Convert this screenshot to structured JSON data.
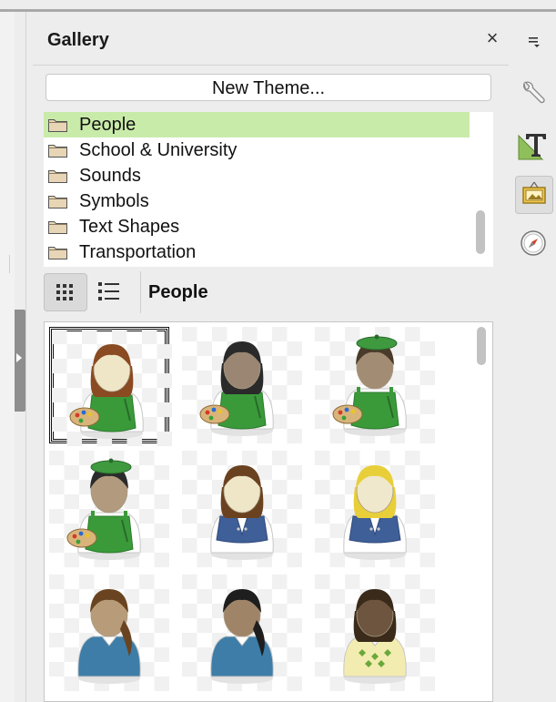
{
  "panel": {
    "title": "Gallery",
    "close_symbol": "×"
  },
  "new_theme_button": {
    "label": "New Theme..."
  },
  "themes": {
    "items": [
      {
        "label": "People",
        "selected": true
      },
      {
        "label": "School & University",
        "selected": false
      },
      {
        "label": "Sounds",
        "selected": false
      },
      {
        "label": "Symbols",
        "selected": false
      },
      {
        "label": "Text Shapes",
        "selected": false
      },
      {
        "label": "Transportation",
        "selected": false
      }
    ]
  },
  "view_toolbar": {
    "icon_view_icon": "grid-icon",
    "detail_view_icon": "list-icon",
    "active_view": "icon",
    "current_theme": "People"
  },
  "gallery_items": [
    {
      "name": "woman-painter-brown-hair",
      "selected": true
    },
    {
      "name": "woman-painter-black-hair",
      "selected": false
    },
    {
      "name": "man-painter-beret",
      "selected": false
    },
    {
      "name": "man-painter-beret-black-hair",
      "selected": false
    },
    {
      "name": "woman-brown-hair-vest",
      "selected": false
    },
    {
      "name": "woman-blonde-vest",
      "selected": false
    },
    {
      "name": "woman-ponytail-blue-sweater",
      "selected": false
    },
    {
      "name": "woman-black-ponytail-blue-sweater",
      "selected": false
    },
    {
      "name": "woman-argyle-sweater",
      "selected": false
    }
  ],
  "sidebar": {
    "menu_icon": "sidebar-menu-icon",
    "buttons": [
      {
        "icon": "properties-wrench-icon",
        "active": false
      },
      {
        "icon": "styles-icon",
        "active": false
      },
      {
        "icon": "gallery-icon",
        "active": true
      },
      {
        "icon": "navigator-icon",
        "active": false
      }
    ]
  },
  "colors": {
    "selected_theme_bg": "#c9eba9",
    "panel_bg": "#ededed",
    "apron_green": "#3a9a3a",
    "sweater_blue": "#3d7da8",
    "vest_blue": "#3f5f98"
  }
}
